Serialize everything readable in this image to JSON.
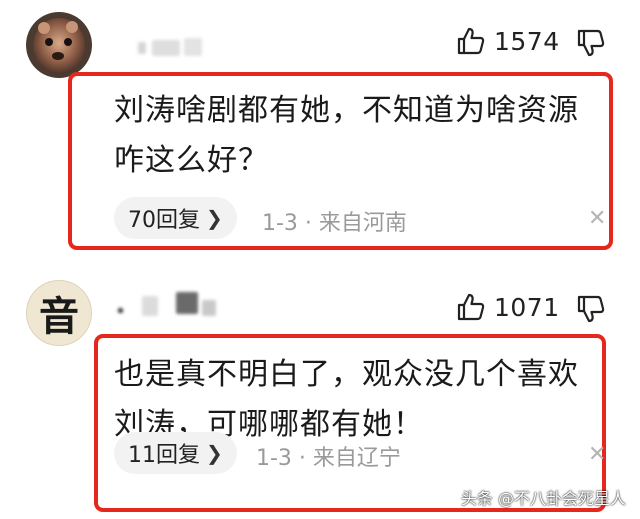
{
  "comments": [
    {
      "avatar_icon": "dog-photo-avatar",
      "likes": "1574",
      "text_lines": [
        "刘涛啥剧都有她，不知道为啥资源",
        "咋这么好？"
      ],
      "reply_label": "70回复",
      "meta": "1-3 · 来自河南",
      "close_icon": "close-icon"
    },
    {
      "avatar_icon": "calligraphy-character-avatar",
      "avatar_char": "音",
      "likes": "1071",
      "text_lines": [
        "也是真不明白了，观众没几个喜欢",
        "刘涛，可哪哪都有她！"
      ],
      "reply_label": "11回复",
      "meta": "1-3 · 来自辽宁",
      "close_icon": "close-icon"
    }
  ],
  "watermark": "头条 @不八卦会死星人",
  "colors": {
    "highlight": "#e6271d",
    "meta_gray": "#9a9a9a",
    "pill_bg": "#f2f2f2"
  }
}
